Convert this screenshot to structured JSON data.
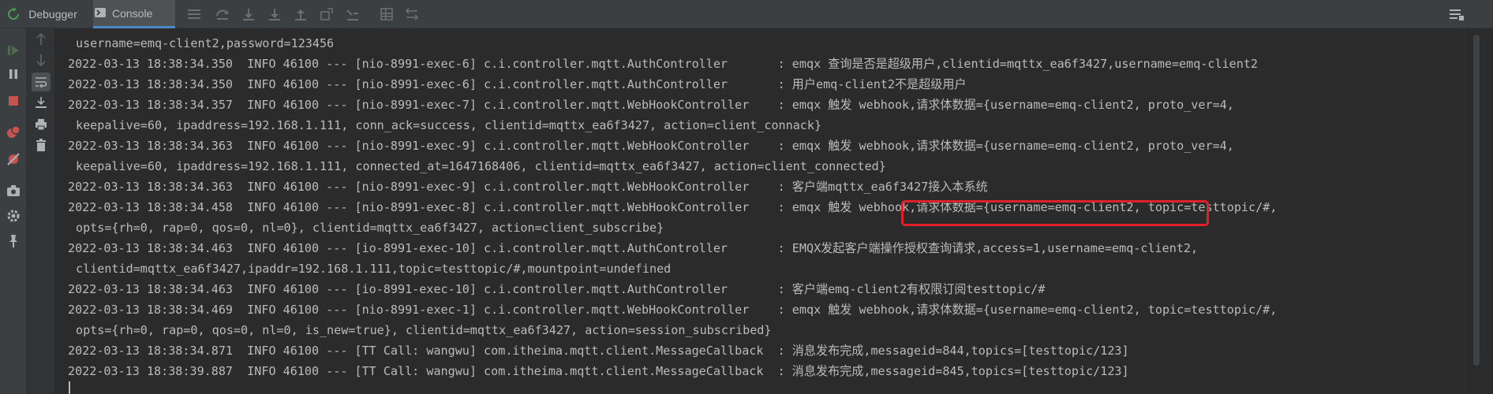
{
  "toolbar": {
    "tabs": [
      {
        "label": "Debugger",
        "icon": "none"
      },
      {
        "label": "Console",
        "icon": "console-icon"
      }
    ],
    "icons": [
      "rerun-icon",
      "menu-icon",
      "step-over-icon",
      "step-into-icon",
      "force-step-into-icon",
      "step-out-icon",
      "drop-frame-icon",
      "run-to-cursor-icon",
      "evaluate-icon",
      "trace-icon",
      "layout-icon"
    ]
  },
  "colors": {
    "accent": "#4a88c7",
    "highlight": "#e0212a",
    "resume": "#499c54",
    "stop": "#c75450"
  },
  "console": {
    "lines": [
      {
        "text": "username=emq-client2,password=123456",
        "continuation": true
      },
      {
        "text": "2022-03-13 18:38:34.350  INFO 46100 --- [nio-8991-exec-6] c.i.controller.mqtt.AuthController       : emqx 查询是否是超级用户,clientid=mqttx_ea6f3427,username=emq-client2",
        "continuation": false
      },
      {
        "text": "2022-03-13 18:38:34.350  INFO 46100 --- [nio-8991-exec-6] c.i.controller.mqtt.AuthController       : 用户emq-client2不是超级用户",
        "continuation": false
      },
      {
        "text": "2022-03-13 18:38:34.357  INFO 46100 --- [nio-8991-exec-7] c.i.controller.mqtt.WebHookController    : emqx 触发 webhook,请求体数据={username=emq-client2, proto_ver=4,",
        "continuation": false
      },
      {
        "text": "keepalive=60, ipaddress=192.168.1.111, conn_ack=success, clientid=mqttx_ea6f3427, action=client_connack}",
        "continuation": true
      },
      {
        "text": "2022-03-13 18:38:34.363  INFO 46100 --- [nio-8991-exec-9] c.i.controller.mqtt.WebHookController    : emqx 触发 webhook,请求体数据={username=emq-client2, proto_ver=4,",
        "continuation": false
      },
      {
        "text": "keepalive=60, ipaddress=192.168.1.111, connected_at=1647168406, clientid=mqttx_ea6f3427, action=client_connected}",
        "continuation": true
      },
      {
        "text": "2022-03-13 18:38:34.363  INFO 46100 --- [nio-8991-exec-9] c.i.controller.mqtt.WebHookController    : 客户端mqttx_ea6f3427接入本系统",
        "continuation": false
      },
      {
        "text": "2022-03-13 18:38:34.458  INFO 46100 --- [nio-8991-exec-8] c.i.controller.mqtt.WebHookController    : emqx 触发 webhook,请求体数据={username=emq-client2, topic=testtopic/#,",
        "continuation": false
      },
      {
        "text": "opts={rh=0, rap=0, qos=0, nl=0}, clientid=mqttx_ea6f3427, action=client_subscribe}",
        "continuation": true
      },
      {
        "text": "2022-03-13 18:38:34.463  INFO 46100 --- [io-8991-exec-10] c.i.controller.mqtt.AuthController       : EMQX发起客户端操作授权查询请求,access=1,username=emq-client2,",
        "continuation": false
      },
      {
        "text": "clientid=mqttx_ea6f3427,ipaddr=192.168.1.111,topic=testtopic/#,mountpoint=undefined",
        "continuation": true
      },
      {
        "text": "2022-03-13 18:38:34.463  INFO 46100 --- [io-8991-exec-10] c.i.controller.mqtt.AuthController       : 客户端emq-client2有权限订阅testtopic/#",
        "continuation": false
      },
      {
        "text": "2022-03-13 18:38:34.469  INFO 46100 --- [nio-8991-exec-1] c.i.controller.mqtt.WebHookController    : emqx 触发 webhook,请求体数据={username=emq-client2, topic=testtopic/#,",
        "continuation": false
      },
      {
        "text": "opts={rh=0, rap=0, qos=0, nl=0, is_new=true}, clientid=mqttx_ea6f3427, action=session_subscribed}",
        "continuation": true
      },
      {
        "text": "2022-03-13 18:38:34.871  INFO 46100 --- [TT Call: wangwu] com.itheima.mqtt.client.MessageCallback  : 消息发布完成,messageid=844,topics=[testtopic/123]",
        "continuation": false
      },
      {
        "text": "2022-03-13 18:38:39.887  INFO 46100 --- [TT Call: wangwu] com.itheima.mqtt.client.MessageCallback  : 消息发布完成,messageid=845,topics=[testtopic/123]",
        "continuation": false
      }
    ]
  }
}
